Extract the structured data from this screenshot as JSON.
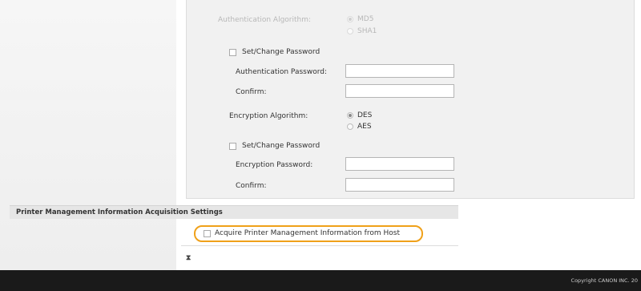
{
  "auth_section": {
    "algorithm_label": "Authentication Algorithm:",
    "algorithm_options": [
      "MD5",
      "SHA1"
    ],
    "selected_algorithm": "MD5",
    "set_change_password_label": "Set/Change Password",
    "password_label": "Authentication Password:",
    "confirm_label": "Confirm:"
  },
  "encryption_section": {
    "algorithm_label": "Encryption Algorithm:",
    "algorithm_options": [
      "DES",
      "AES"
    ],
    "selected_algorithm": "DES",
    "set_change_password_label": "Set/Change Password",
    "password_label": "Encryption Password:",
    "confirm_label": "Confirm:"
  },
  "printer_mgmt": {
    "title": "Printer Management Information Acquisition Settings",
    "checkbox_label": "Acquire Printer Management Information from Host"
  },
  "back_to_top_glyph": "⧗",
  "footer": {
    "copyright": "Copyright CANON INC. 20"
  },
  "colors": {
    "highlight": "#f0a11a",
    "footer_bg": "#1a1a1a"
  }
}
